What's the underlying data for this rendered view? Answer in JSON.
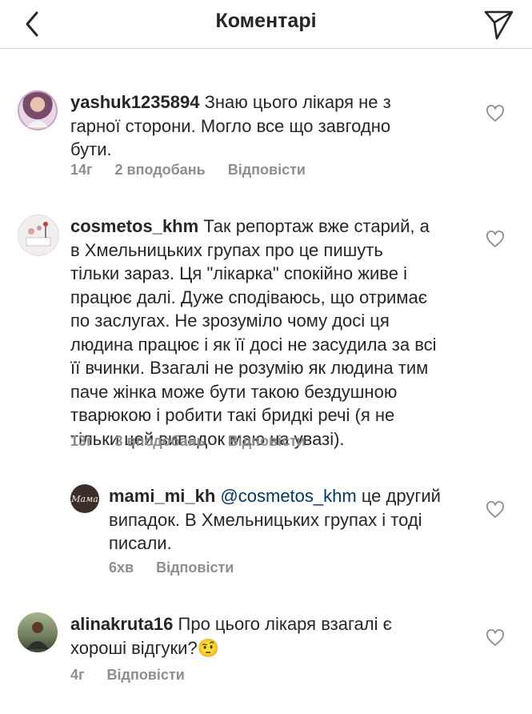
{
  "header": {
    "title": "Коментарі"
  },
  "comments": [
    {
      "username": "yashuk1235894",
      "text": "Знаю цього лікаря не з\nгарної сторони. Могло все що завгодно\nбути.",
      "time": "14г",
      "likes": "2 вподобань",
      "reply": "Відповісти"
    },
    {
      "username": "cosmetos_khm",
      "text": "Так репортаж вже старий, а\nв Хмельницьких групах про це пишуть\nтільки зараз. Ця \"лікарка\" спокійно живе і\nпрацює далі. Дуже сподіваюсь, що отримає\nпо заслугах. Не зрозуміло чому досі ця\nлюдина працює і як її досі не засудила за всі\nїї вчинки. Взагалі не розумію як людина тим\nпаче жінка може бути такою бездушною\nтварюкою і робити такі бридкі речі (я не\nтільки цей випадок маю на увазі).",
      "time": "13г",
      "likes": "3 вподобань",
      "reply": "Відповісти"
    },
    {
      "username": "mami_mi_kh",
      "mention": "@cosmetos_khm",
      "text": "це другий\nвипадок. В Хмельницьких групах і тоді\nписали.",
      "time": "6хв",
      "reply": "Відповісти",
      "avatar_text": "Мама"
    },
    {
      "username": "alinakruta16",
      "text": "Про цього лікаря взагалі є\nхороші відгуки?",
      "emoji": "🤨",
      "time": "4г",
      "reply": "Відповісти"
    }
  ],
  "colors": {
    "text": "#262626",
    "meta": "#8e8e8e",
    "mention": "#00376b",
    "divider": "#dbdbdb"
  }
}
